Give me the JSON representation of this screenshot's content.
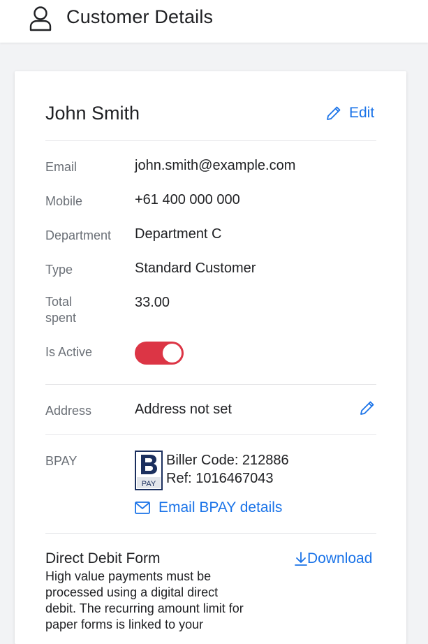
{
  "header": {
    "title": "Customer Details",
    "icon": "person-icon"
  },
  "customer": {
    "name": "John Smith",
    "edit_label": "Edit"
  },
  "fields": {
    "email": {
      "label": "Email",
      "value": "john.smith@example.com"
    },
    "mobile": {
      "label": "Mobile",
      "value": "+61 400 000 000"
    },
    "department": {
      "label": "Department",
      "value": "Department C"
    },
    "type": {
      "label": "Type",
      "value": "Standard Customer"
    },
    "total_spent": {
      "label": "Total spent",
      "value": "33.00"
    },
    "is_active": {
      "label": "Is Active",
      "value": true
    }
  },
  "address": {
    "label": "Address",
    "value": "Address not set"
  },
  "bpay": {
    "label": "BPAY",
    "logo_text": "PAY",
    "biller_code": "Biller Code: 212886",
    "ref": "Ref: 1016467043",
    "email_label": "Email BPAY details"
  },
  "direct_debit": {
    "title": "Direct Debit Form",
    "download_label": "Download",
    "description": "High value payments must be processed using a digital direct debit. The recurring amount limit for paper forms is linked to your"
  },
  "colors": {
    "accent": "#1a73e8",
    "toggle_active": "#dc3545",
    "bpay_navy": "#1b2f5e"
  }
}
